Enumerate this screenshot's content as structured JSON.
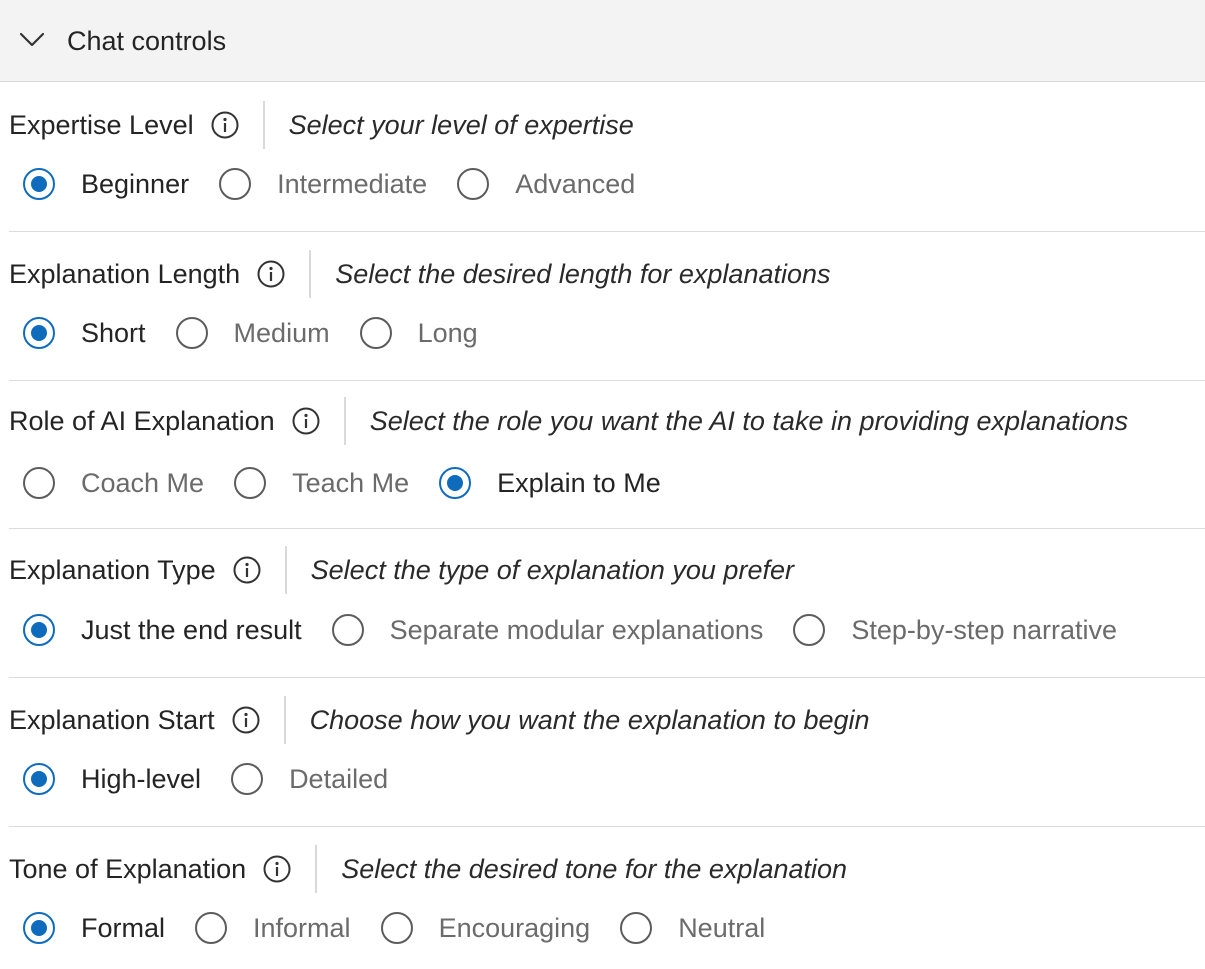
{
  "panel": {
    "title": "Chat controls"
  },
  "sections": [
    {
      "title": "Expertise Level",
      "description": "Select your level of expertise",
      "options": [
        "Beginner",
        "Intermediate",
        "Advanced"
      ],
      "selected": 0
    },
    {
      "title": "Explanation Length",
      "description": "Select the desired length for explanations",
      "options": [
        "Short",
        "Medium",
        "Long"
      ],
      "selected": 0
    },
    {
      "title": "Role of AI Explanation",
      "description": "Select the role you want the AI to take in providing explanations",
      "options": [
        "Coach Me",
        "Teach Me",
        "Explain to Me"
      ],
      "selected": 2
    },
    {
      "title": "Explanation Type",
      "description": "Select the type of explanation you prefer",
      "options": [
        "Just the end result",
        "Separate modular explanations",
        "Step-by-step narrative"
      ],
      "selected": 0
    },
    {
      "title": "Explanation Start",
      "description": "Choose how you want the explanation to begin",
      "options": [
        "High-level",
        "Detailed"
      ],
      "selected": 0
    },
    {
      "title": "Tone of Explanation",
      "description": "Select the desired tone for the explanation",
      "options": [
        "Formal",
        "Informal",
        "Encouraging",
        "Neutral"
      ],
      "selected": 0
    }
  ],
  "colors": {
    "accent": "#0f6cbd",
    "header_bg": "#f3f3f3"
  }
}
